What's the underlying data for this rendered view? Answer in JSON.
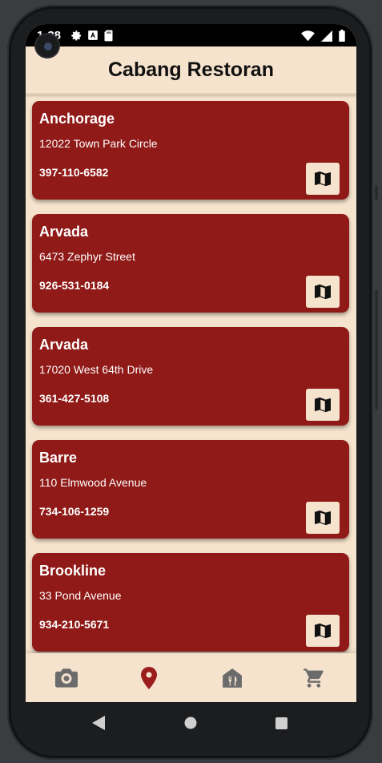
{
  "status_bar": {
    "time": "1:38",
    "left_icons": [
      "gear-icon",
      "text-a-icon",
      "sd-card-icon"
    ],
    "right_icons": [
      "wifi-icon",
      "signal-icon",
      "battery-icon"
    ]
  },
  "app_bar": {
    "title": "Cabang Restoran"
  },
  "branches": [
    {
      "name": "Anchorage",
      "address": "12022 Town Park Circle",
      "phone": "397-110-6582"
    },
    {
      "name": "Arvada",
      "address": "6473 Zephyr Street",
      "phone": "926-531-0184"
    },
    {
      "name": "Arvada",
      "address": "17020 West 64th Drive",
      "phone": "361-427-5108"
    },
    {
      "name": "Barre",
      "address": "110 Elmwood Avenue",
      "phone": "734-106-1259"
    },
    {
      "name": "Brookline",
      "address": "33 Pond Avenue",
      "phone": "934-210-5671"
    }
  ],
  "card_action_icon": "map-icon",
  "bottom_nav": [
    {
      "icon": "camera-icon",
      "active": false
    },
    {
      "icon": "location-pin-icon",
      "active": true
    },
    {
      "icon": "restaurant-house-icon",
      "active": false
    },
    {
      "icon": "cart-icon",
      "active": false
    }
  ],
  "colors": {
    "card": "#8f1a17",
    "background": "#f6e3cd",
    "nav_active": "#9b1c1c",
    "nav_inactive": "#6b6b6b"
  },
  "system_nav": [
    "back-icon",
    "home-icon",
    "recents-icon"
  ]
}
